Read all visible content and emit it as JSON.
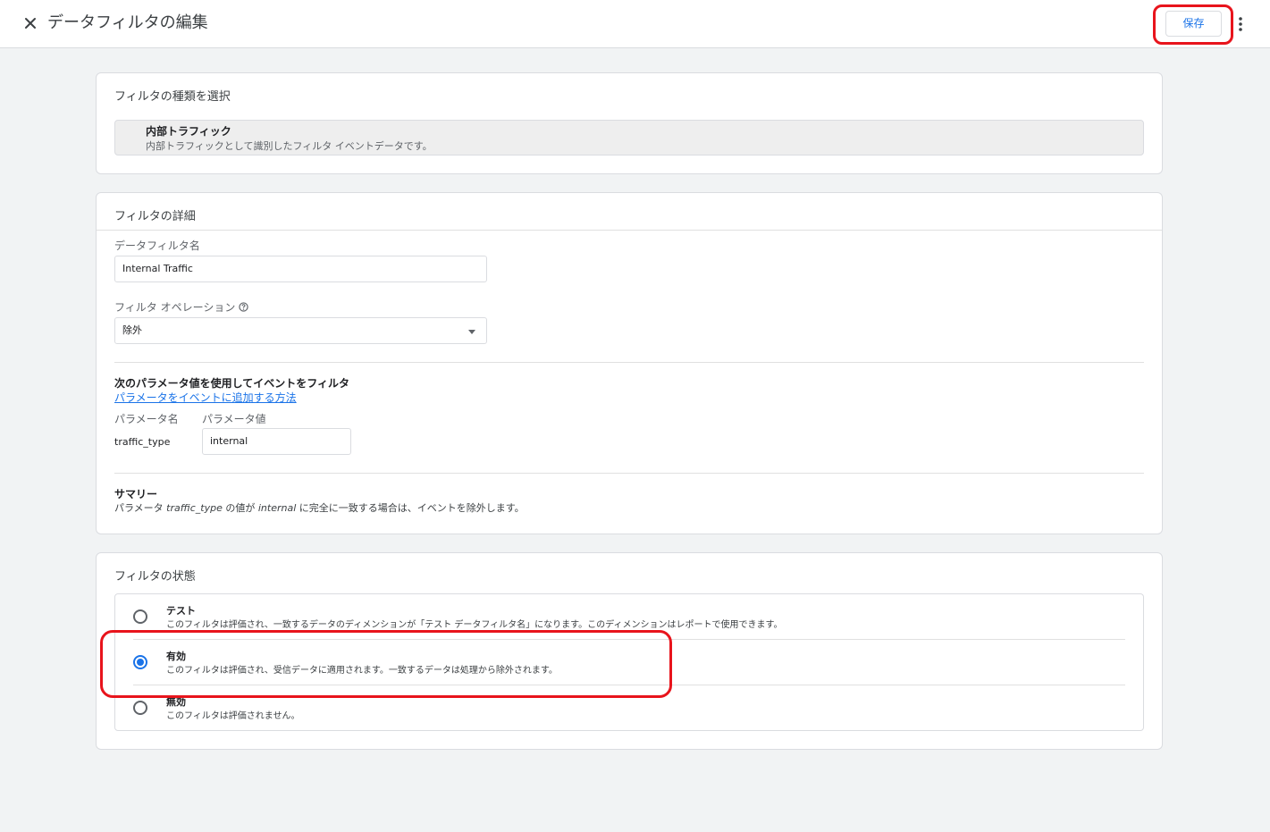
{
  "header": {
    "title": "データフィルタの編集",
    "save_label": "保存"
  },
  "filter_type": {
    "section_title": "フィルタの種類を選択",
    "name": "内部トラフィック",
    "description": "内部トラフィックとして識別したフィルタ イベントデータです。"
  },
  "details": {
    "section_title": "フィルタの詳細",
    "name_label": "データフィルタ名",
    "name_value": "Internal Traffic",
    "operation_label": "フィルタ オペレーション",
    "operation_value": "除外",
    "param_heading": "次のパラメータ値を使用してイベントをフィルタ",
    "param_link": "パラメータをイベントに追加する方法",
    "param_name_label": "パラメータ名",
    "param_value_label": "パラメータ値",
    "param_name": "traffic_type",
    "param_value": "internal",
    "summary_heading": "サマリー",
    "summary": {
      "p1": "パラメータ ",
      "param": "traffic_type",
      "p2": " の値が ",
      "value": "internal",
      "p3": " に完全に一致する場合は、イベントを除外します。"
    }
  },
  "status": {
    "section_title": "フィルタの状態",
    "options": [
      {
        "title": "テスト",
        "description": "このフィルタは評価され、一致するデータのディメンションが「テスト データフィルタ名」になります。このディメンションはレポートで使用できます。",
        "selected": false
      },
      {
        "title": "有効",
        "description": "このフィルタは評価され、受信データに適用されます。一致するデータは処理から除外されます。",
        "selected": true
      },
      {
        "title": "無効",
        "description": "このフィルタは評価されません。",
        "selected": false
      }
    ]
  },
  "colors": {
    "accent": "#1a73e8",
    "annotation": "#e8141c"
  }
}
